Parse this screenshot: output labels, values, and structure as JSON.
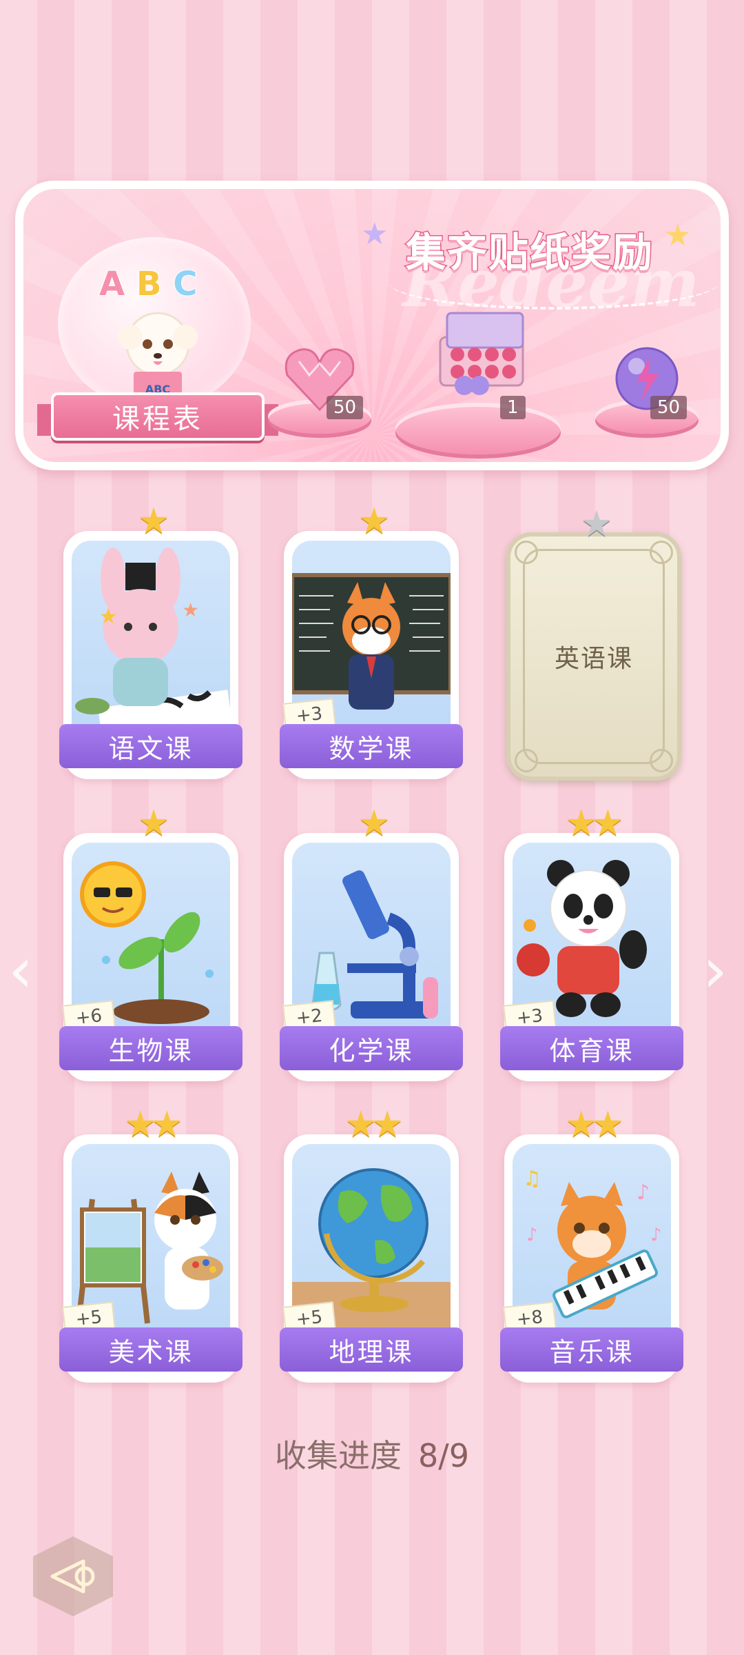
{
  "banner": {
    "title": "集齐贴纸奖励",
    "watermark": "Redeem",
    "schedule_label": "课程表",
    "schedule_book_text": "ABC",
    "abc_letters": [
      "A",
      "B",
      "C"
    ],
    "rewards": [
      {
        "name": "heart-gem",
        "count": "50"
      },
      {
        "name": "gift-box",
        "count": "1"
      },
      {
        "name": "energy-orb",
        "count": "50"
      }
    ]
  },
  "courses": [
    {
      "label": "语文课",
      "stars": 1,
      "bonus": "",
      "locked": false,
      "icon": "bunny-calligraphy"
    },
    {
      "label": "数学课",
      "stars": 1,
      "bonus": "+3",
      "locked": false,
      "icon": "fox-teacher"
    },
    {
      "label": "英语课",
      "stars": 1,
      "bonus": "",
      "locked": true,
      "icon": "locked-card"
    },
    {
      "label": "生物课",
      "stars": 1,
      "bonus": "+6",
      "locked": false,
      "icon": "sun-sprout"
    },
    {
      "label": "化学课",
      "stars": 1,
      "bonus": "+2",
      "locked": false,
      "icon": "microscope"
    },
    {
      "label": "体育课",
      "stars": 2,
      "bonus": "+3",
      "locked": false,
      "icon": "panda-pingpong"
    },
    {
      "label": "美术课",
      "stars": 2,
      "bonus": "+5",
      "locked": false,
      "icon": "cat-painter"
    },
    {
      "label": "地理课",
      "stars": 2,
      "bonus": "+5",
      "locked": false,
      "icon": "globe"
    },
    {
      "label": "音乐课",
      "stars": 2,
      "bonus": "+8",
      "locked": false,
      "icon": "cat-keyboard"
    }
  ],
  "progress": {
    "label": "收集进度",
    "value": "8/9"
  },
  "colors": {
    "accent_purple": "#8b5fd8",
    "pink": "#f58fae",
    "star_gold": "#f7c63d"
  }
}
